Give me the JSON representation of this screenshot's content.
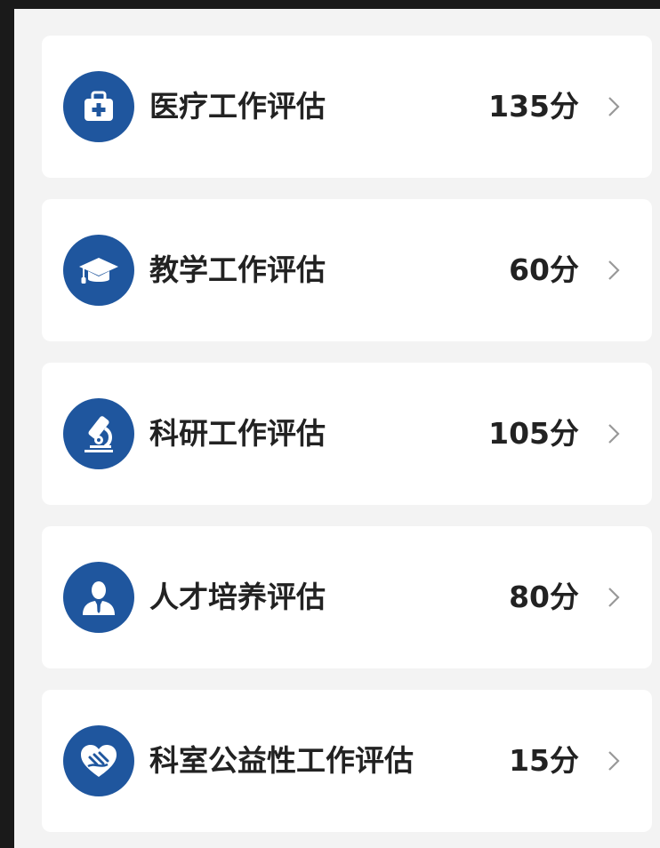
{
  "items": [
    {
      "label": "医疗工作评估",
      "score": "135分",
      "icon": "medical-kit-icon"
    },
    {
      "label": "教学工作评估",
      "score": "60分",
      "icon": "graduation-cap-icon"
    },
    {
      "label": "科研工作评估",
      "score": "105分",
      "icon": "microscope-icon"
    },
    {
      "label": "人才培养评估",
      "score": "80分",
      "icon": "person-icon"
    },
    {
      "label": "科室公益性工作评估",
      "score": "15分",
      "icon": "heart-hand-icon"
    }
  ],
  "colors": {
    "accent": "#1f569e",
    "background": "#f3f3f3",
    "card": "#ffffff",
    "text": "#222222",
    "chevron": "#999999"
  }
}
